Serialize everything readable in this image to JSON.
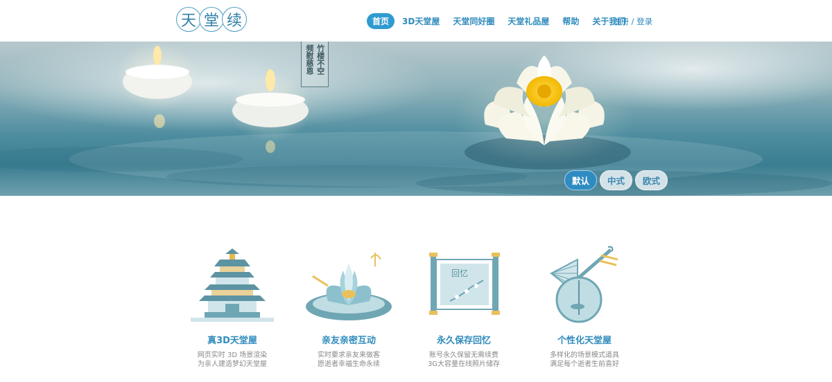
{
  "header": {
    "logo_chars": [
      "天",
      "堂",
      "续"
    ],
    "nav": [
      {
        "label": "首页",
        "active": true
      },
      {
        "label": "3D天堂屋",
        "active": false
      },
      {
        "label": "天堂同好圈",
        "active": false
      },
      {
        "label": "天堂礼品屋",
        "active": false
      },
      {
        "label": "帮助",
        "active": false
      },
      {
        "label": "关于我们",
        "active": false
      }
    ],
    "auth": "注册 / 登录"
  },
  "banner": {
    "poem_columns": [
      "竹楼不空",
      "频慰慈恩"
    ],
    "theme_buttons": [
      {
        "label": "默认",
        "active": true
      },
      {
        "label": "中式",
        "active": false
      },
      {
        "label": "欧式",
        "active": false
      }
    ]
  },
  "features": [
    {
      "icon": "pagoda-icon",
      "title": "真3D天堂屋",
      "desc": [
        "网页实时 3D 场景渲染",
        "为亲人建造梦幻天堂屋"
      ]
    },
    {
      "icon": "lotus-icon",
      "title": "亲友亲密互动",
      "desc": [
        "实时要求亲友来做客",
        "愿逝者幸福生命永续"
      ]
    },
    {
      "icon": "scroll-icon",
      "title": "永久保存回忆",
      "desc": [
        "账号永久保留无需续费",
        "3G大容量在线照片储存"
      ],
      "scroll_text": "回忆"
    },
    {
      "icon": "pipa-fan-icon",
      "title": "个性化天堂屋",
      "desc": [
        "多样化的场景模式道具",
        "满足每个逝者生前喜好"
      ]
    }
  ],
  "colors": {
    "accent": "#2f9bd0",
    "feature_teal": "#6fa6b4",
    "feature_light": "#bfdde3"
  }
}
